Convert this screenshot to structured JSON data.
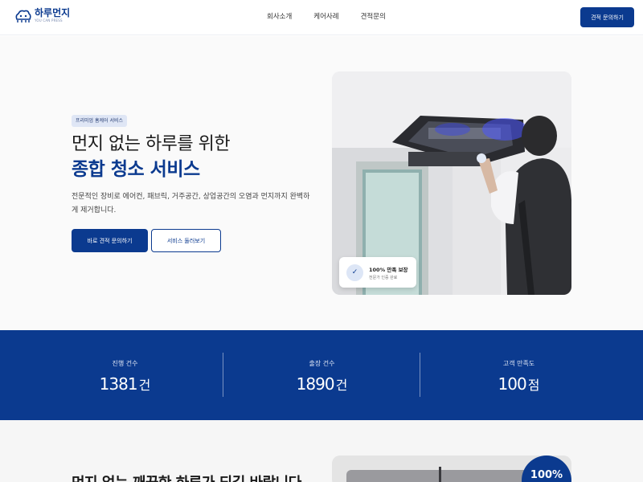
{
  "header": {
    "logo_name": "하루먼지",
    "logo_sub": "YOU CAN PRESS",
    "nav": [
      {
        "label": "회사소개"
      },
      {
        "label": "케어사례"
      },
      {
        "label": "견적문의"
      }
    ],
    "cta_label": "견적 문의하기"
  },
  "hero": {
    "badge": "프리미엄 홈케어 서비스",
    "title_line1": "먼지 없는 하루를 위한",
    "title_line2": "종합 청소 서비스",
    "description": "전문적인 장비로 에어컨, 패브릭, 거주공간, 상업공간의 오염과 먼지까지 완벽하게 제거합니다.",
    "primary_button": "바로 견적 문의하기",
    "secondary_button": "서비스 둘러보기",
    "assurance": {
      "icon": "check-icon",
      "title": "100% 만족 보장",
      "subtitle": "전문가 인증 완료"
    }
  },
  "stats": [
    {
      "label": "진행 건수",
      "value": "1381",
      "unit": "건"
    },
    {
      "label": "출장 건수",
      "value": "1890",
      "unit": "건"
    },
    {
      "label": "고객 만족도",
      "value": "100",
      "unit": "점"
    }
  ],
  "section2": {
    "title": "먼지 없는 깨끗한 하루가 되길 바랍니다",
    "badge": "100%"
  },
  "colors": {
    "brand": "#0b3a8f",
    "badge_bg": "#dfe6f5"
  }
}
